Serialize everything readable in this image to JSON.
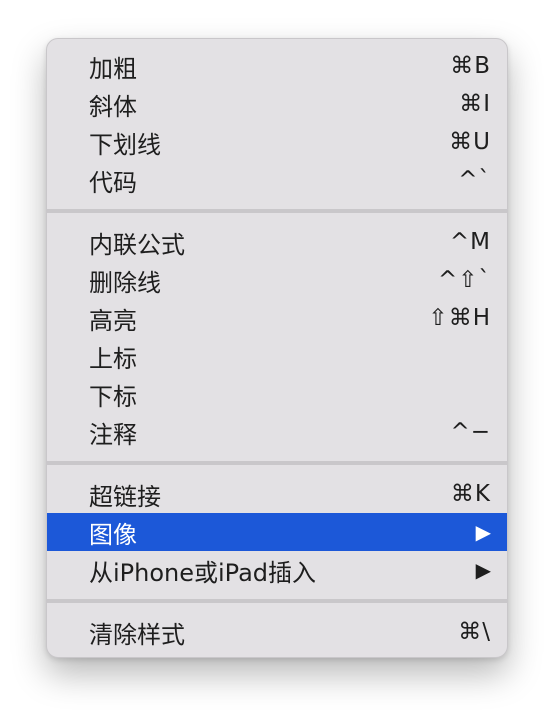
{
  "menu": {
    "groups": [
      {
        "items": [
          {
            "label": "加粗",
            "shortcut": "⌘B"
          },
          {
            "label": "斜体",
            "shortcut": "⌘I"
          },
          {
            "label": "下划线",
            "shortcut": "⌘U"
          },
          {
            "label": "代码",
            "shortcut": "^`"
          }
        ]
      },
      {
        "items": [
          {
            "label": "内联公式",
            "shortcut": "^M"
          },
          {
            "label": "删除线",
            "shortcut": "^⇧`"
          },
          {
            "label": "高亮",
            "shortcut": "⇧⌘H"
          },
          {
            "label": "上标",
            "shortcut": ""
          },
          {
            "label": "下标",
            "shortcut": ""
          },
          {
            "label": "注释",
            "shortcut": "^−"
          }
        ]
      },
      {
        "items": [
          {
            "label": "超链接",
            "shortcut": "⌘K"
          },
          {
            "label": "图像",
            "submenu_arrow": "▶",
            "highlighted": true
          },
          {
            "label": "从iPhone或iPad插入",
            "submenu_arrow": "▶"
          }
        ]
      },
      {
        "items": [
          {
            "label": "清除样式",
            "shortcut": "⌘\\"
          }
        ]
      }
    ]
  }
}
